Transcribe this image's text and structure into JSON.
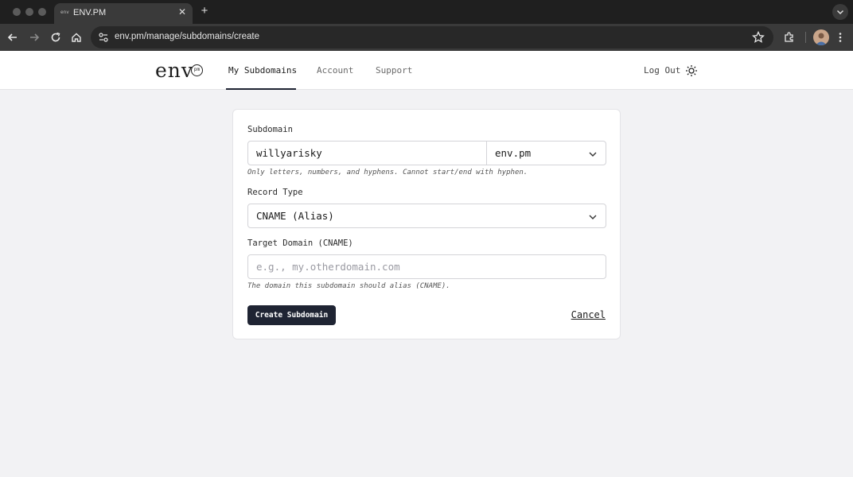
{
  "browser": {
    "tab_title": "ENV.PM",
    "tab_favicon_text": "env",
    "url": "env.pm/manage/subdomains/create"
  },
  "header": {
    "logo_text": "env",
    "logo_badge": "pm",
    "nav": [
      {
        "label": "My Subdomains",
        "active": true
      },
      {
        "label": "Account",
        "active": false
      },
      {
        "label": "Support",
        "active": false
      }
    ],
    "logout_label": "Log Out"
  },
  "form": {
    "subdomain_label": "Subdomain",
    "subdomain_value": "willyarisky",
    "domain_selected": "env.pm",
    "subdomain_hint": "Only letters, numbers, and hyphens. Cannot start/end with hyphen.",
    "record_type_label": "Record Type",
    "record_type_selected": "CNAME (Alias)",
    "target_label": "Target Domain (CNAME)",
    "target_placeholder": "e.g., my.otherdomain.com",
    "target_hint": "The domain this subdomain should alias (CNAME).",
    "submit_label": "Create Subdomain",
    "cancel_label": "Cancel"
  },
  "colors": {
    "accent": "#1f2433",
    "page_bg": "#f2f2f4"
  }
}
